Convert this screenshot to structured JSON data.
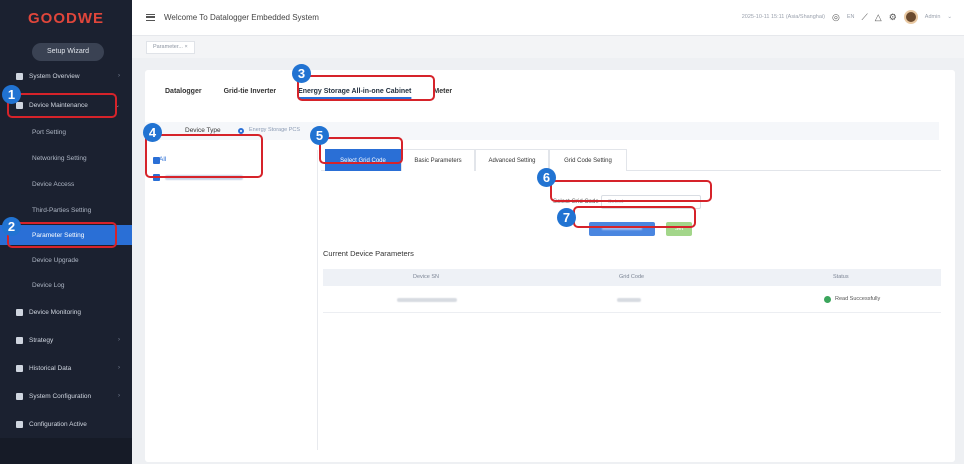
{
  "sidebar": {
    "logo": "GOODWE",
    "setup_wizard": "Setup Wizard",
    "menus": [
      {
        "label": "System Overview",
        "icon": "dashboard-icon"
      },
      {
        "label": "Device Maintenance",
        "icon": "wrench-icon"
      },
      {
        "label": "Device Monitoring",
        "icon": "monitor-icon"
      },
      {
        "label": "Strategy",
        "icon": "strategy-icon"
      },
      {
        "label": "Historical Data",
        "icon": "chart-icon"
      },
      {
        "label": "System Configuration",
        "icon": "gear-icon"
      },
      {
        "label": "Configuration Active",
        "icon": "config-icon"
      }
    ],
    "subitems": [
      "Port Setting",
      "Networking Setting",
      "Device Access",
      "Third-Parties Setting",
      "Parameter Setting",
      "Device Upgrade",
      "Device Log"
    ]
  },
  "topbar": {
    "welcome": "Welcome To Datalogger Embedded System",
    "datetime": "2025-10-11 15:11 (Asia/Shanghai)",
    "language": "EN",
    "user": "Admin"
  },
  "page_tab": "Parameter...",
  "main": {
    "device_tabs": [
      "Datalogger",
      "Grid-tie Inverter",
      "Energy Storage All-in-one Cabinet",
      "Meter"
    ],
    "device_type_label": "Device Type",
    "device_type_value": "Energy Storage PCS",
    "tree_all": "All",
    "sub_tabs": [
      "Select Grid Code",
      "Basic Parameters",
      "Advanced Setting",
      "Grid Code Setting"
    ],
    "grid_code_label": "Select Grid Code",
    "grid_code_placeholder": "Select",
    "set_button": "Set",
    "current_params_title": "Current Device Parameters",
    "table_headers": [
      "Device SN",
      "Grid Code",
      "Status"
    ],
    "row_status": "Read Successfully"
  },
  "annotations": [
    "1",
    "2",
    "3",
    "4",
    "5",
    "6",
    "7"
  ],
  "colors": {
    "accent": "#2a6fd6",
    "callout": "#d6232a",
    "badge": "#2173d2",
    "success": "#3ba55c"
  }
}
